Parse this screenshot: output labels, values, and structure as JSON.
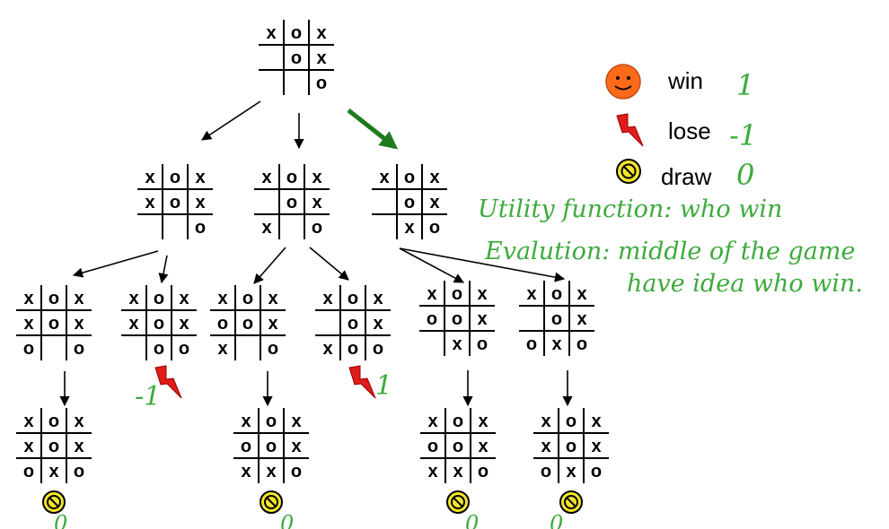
{
  "colors": {
    "line": "#000000",
    "highlight_arrow": "#1e7a1e",
    "handwriting": "#3daa3d",
    "win_face": "#ff6a1a",
    "lose_bolt": "#e01b1b",
    "draw_icon": "#f3e52a"
  },
  "legend": [
    {
      "key": "win",
      "label": "win",
      "icon": "smiley-face-icon",
      "annotation": "1"
    },
    {
      "key": "lose",
      "label": "lose",
      "icon": "lightning-bolt-icon",
      "annotation": "-1"
    },
    {
      "key": "draw",
      "label": "draw",
      "icon": "no-entry-icon",
      "annotation": "0"
    }
  ],
  "handwritten_notes": [
    "Utility function: who win",
    "Evalution: middle of the game",
    "have idea who win."
  ],
  "boards": [
    {
      "id": "root",
      "cells": [
        "x",
        "o",
        "x",
        "",
        "o",
        "x",
        "",
        "",
        "o"
      ]
    },
    {
      "id": "l1a",
      "cells": [
        "x",
        "o",
        "x",
        "x",
        "o",
        "x",
        "",
        "",
        "o"
      ]
    },
    {
      "id": "l1b",
      "cells": [
        "x",
        "o",
        "x",
        "",
        "o",
        "x",
        "x",
        "",
        "o"
      ]
    },
    {
      "id": "l1c",
      "cells": [
        "x",
        "o",
        "x",
        "",
        "o",
        "x",
        "",
        "x",
        "o"
      ]
    },
    {
      "id": "l2a",
      "cells": [
        "x",
        "o",
        "x",
        "x",
        "o",
        "x",
        "o",
        "",
        "o"
      ]
    },
    {
      "id": "l2b",
      "cells": [
        "x",
        "o",
        "x",
        "x",
        "o",
        "x",
        "",
        "o",
        "o"
      ]
    },
    {
      "id": "l2c",
      "cells": [
        "x",
        "o",
        "x",
        "o",
        "o",
        "x",
        "x",
        "",
        "o"
      ]
    },
    {
      "id": "l2d",
      "cells": [
        "x",
        "o",
        "x",
        "",
        "o",
        "x",
        "x",
        "o",
        "o"
      ]
    },
    {
      "id": "l2e",
      "cells": [
        "x",
        "o",
        "x",
        "o",
        "o",
        "x",
        "",
        "x",
        "o"
      ]
    },
    {
      "id": "l2f",
      "cells": [
        "x",
        "o",
        "x",
        "",
        "o",
        "x",
        "o",
        "x",
        "o"
      ]
    },
    {
      "id": "l3a",
      "cells": [
        "x",
        "o",
        "x",
        "x",
        "o",
        "x",
        "o",
        "x",
        "o"
      ]
    },
    {
      "id": "l3b",
      "cells": [
        "x",
        "o",
        "x",
        "o",
        "o",
        "x",
        "x",
        "x",
        "o"
      ]
    },
    {
      "id": "l3c",
      "cells": [
        "x",
        "o",
        "x",
        "o",
        "o",
        "x",
        "x",
        "x",
        "o"
      ]
    },
    {
      "id": "l3d",
      "cells": [
        "x",
        "o",
        "x",
        "x",
        "o",
        "x",
        "o",
        "x",
        "o"
      ]
    }
  ],
  "outcomes": [
    {
      "board": "l2b",
      "result": "lose",
      "annotation": "-1"
    },
    {
      "board": "l2d",
      "result": "lose",
      "annotation": "1"
    },
    {
      "board": "l3a",
      "result": "draw",
      "annotation": "0"
    },
    {
      "board": "l3b",
      "result": "draw",
      "annotation": "0"
    },
    {
      "board": "l3c",
      "result": "draw",
      "annotation": "0"
    },
    {
      "board": "l3d",
      "result": "draw",
      "annotation": "0"
    }
  ]
}
